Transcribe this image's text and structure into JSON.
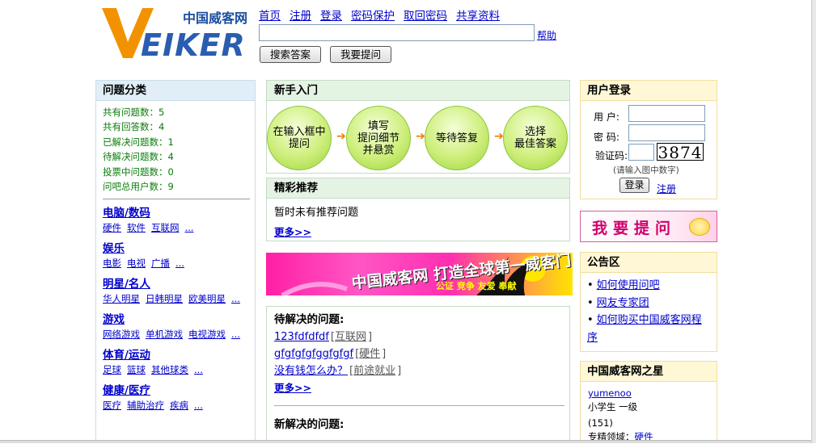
{
  "brand": {
    "logo_letters": "VEIKER",
    "logo_cn": "中国威客网"
  },
  "topnav": [
    "首页",
    "注册",
    "登录",
    "密码保护",
    "取回密码",
    "共享资料"
  ],
  "search": {
    "value": "",
    "help": "帮助",
    "btn_search": "搜索答案",
    "btn_ask": "我要提问"
  },
  "left": {
    "title": "问题分类",
    "stats": [
      "共有问题数：5",
      "共有回答数：4",
      "已解决问题数：1",
      "待解决问题数：4",
      "投票中问题数：0",
      "问吧总用户数：9"
    ],
    "categories": [
      {
        "title": "电脑/数码",
        "subs": [
          "硬件",
          "软件",
          "互联网",
          "..."
        ]
      },
      {
        "title": "娱乐",
        "subs": [
          "电影",
          "电视",
          "广播",
          "..."
        ]
      },
      {
        "title": "明星/名人",
        "subs": [
          "华人明星",
          "日韩明星",
          "欧美明星",
          "..."
        ]
      },
      {
        "title": "游戏",
        "subs": [
          "网络游戏",
          "单机游戏",
          "电视游戏",
          "..."
        ]
      },
      {
        "title": "体育/运动",
        "subs": [
          "足球",
          "篮球",
          "其他球类",
          "..."
        ]
      },
      {
        "title": "健康/医疗",
        "subs": [
          "医疗",
          "辅助治疗",
          "疾病",
          "..."
        ]
      }
    ]
  },
  "newbie": {
    "title": "新手入门",
    "steps": [
      [
        "在输入框中",
        "提问"
      ],
      [
        "填写",
        "提问细节",
        "并悬赏"
      ],
      [
        "等待答复"
      ],
      [
        "选择",
        "最佳答案"
      ]
    ],
    "arrow": "➔"
  },
  "recommend": {
    "title": "精彩推荐",
    "empty": "暂时未有推荐问题",
    "more": "更多>>"
  },
  "banner": {
    "title": "中国威客网 打造全球第一威客门户",
    "sub": "公证  竞争  友爱  奉献"
  },
  "pending": {
    "title": "待解决的问题:",
    "items": [
      {
        "q": "123fdfdfdf",
        "tag": "互联网"
      },
      {
        "q": "gfgfgfgfggfgfgf",
        "tag": "硬件"
      },
      {
        "q": "没有钱怎么办？",
        "tag": "前途就业"
      }
    ],
    "more": "更多>>",
    "new_title": "新解决的问题:"
  },
  "login": {
    "title": "用户登录",
    "user_label": "用  户:",
    "pass_label": "密  码:",
    "code_label": "验证码:",
    "captcha": "3874",
    "hint": "(请输入图中数字)",
    "login_btn": "登录",
    "register": "注册"
  },
  "ask_banner": "我要提问",
  "notice": {
    "title": "公告区",
    "items": [
      "如何使用问吧",
      "网友专家团",
      "如何购买中国威客网程序"
    ]
  },
  "stars": {
    "title": "中国威客网之星",
    "user": "yumenoo",
    "level": "小学生  一级",
    "score": "(151)",
    "field_label": "专精领域：",
    "field": "硬件"
  }
}
